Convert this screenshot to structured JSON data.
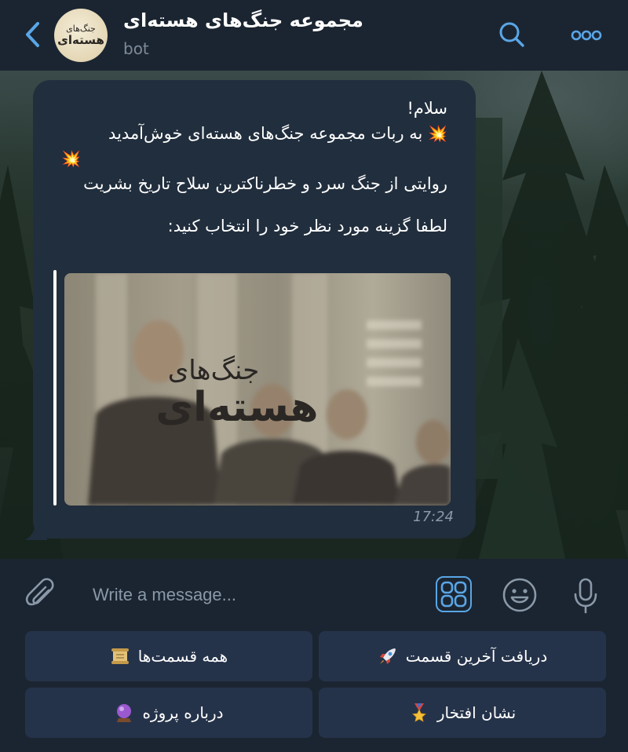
{
  "header": {
    "title": "مجموعه جنگ‌های هسته‌ای",
    "subtitle": "bot",
    "avatar_line1": "جنگ‌های",
    "avatar_line2": "هسته‌ای",
    "back_icon": "chevron-left-icon",
    "search_icon": "search-icon",
    "more_icon": "more-dots-icon",
    "accent_color": "#5aa6e6"
  },
  "message": {
    "greeting": "سلام!",
    "welcome": "به ربات مجموعه جنگ‌های هسته‌ای خوش‌آمدید",
    "emoji": "💥",
    "description": "روایتی از جنگ سرد و خطرناکترین سلاح تاریخ بشریت",
    "prompt": "لطفا گزینه مورد نظر خود را انتخاب کنید:",
    "photo_caption_line1": "جنگ‌های",
    "photo_caption_line2": "هسته‌ای",
    "time": "17:24"
  },
  "composer": {
    "placeholder": "Write a message...",
    "attach_icon": "paperclip-icon",
    "keyboard_icon": "bot-keyboard-icon",
    "emoji_icon": "smiley-icon",
    "mic_icon": "microphone-icon"
  },
  "keyboard": {
    "buttons": [
      {
        "label": "دریافت آخرین قسمت",
        "icon": "rocket-icon"
      },
      {
        "label": "همه قسمت‌ها",
        "icon": "scroll-icon"
      },
      {
        "label": "نشان افتخار",
        "icon": "medal-icon"
      },
      {
        "label": "درباره پروژه",
        "icon": "crystal-ball-icon"
      }
    ]
  }
}
